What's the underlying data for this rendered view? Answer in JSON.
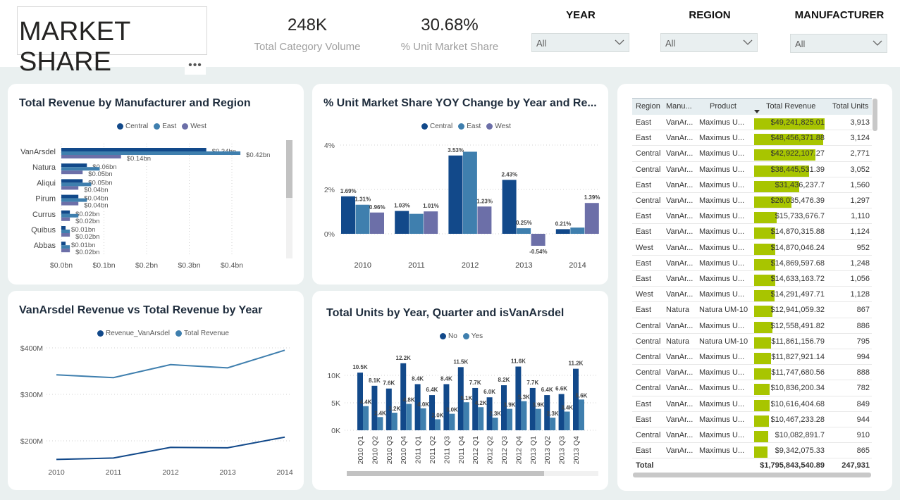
{
  "header": {
    "title": "MARKET SHARE",
    "more": "•••",
    "kpi1": {
      "value": "248K",
      "label": "Total Category Volume"
    },
    "kpi2": {
      "value": "30.68%",
      "label": "% Unit Market Share"
    },
    "slicers": [
      {
        "title": "YEAR",
        "value": "All"
      },
      {
        "title": "REGION",
        "value": "All"
      },
      {
        "title": "MANUFACTURER",
        "value": "All"
      }
    ]
  },
  "colors": {
    "central": "#12498a",
    "east": "#3f7fae",
    "west": "#6c6fa8",
    "no": "#12498a",
    "yes": "#3f7fae",
    "bar_green": "#a8c500"
  },
  "revenue_chart": {
    "title": "Total Revenue by Manufacturer and Region",
    "legend": [
      "Central",
      "East",
      "West"
    ],
    "chart_data": {
      "type": "bar",
      "categories": [
        "VanArsdel",
        "Natura",
        "Aliqui",
        "Pirum",
        "Currus",
        "Quibus",
        "Abbas"
      ],
      "series": [
        {
          "name": "Central",
          "values": [
            0.34,
            0.06,
            0.05,
            0.04,
            0.02,
            0.01,
            0.01
          ]
        },
        {
          "name": "East",
          "values": [
            0.42,
            0.09,
            0.07,
            0.06,
            0.04,
            0.02,
            0.02
          ]
        },
        {
          "name": "West",
          "values": [
            0.14,
            0.05,
            0.04,
            0.04,
            0.02,
            0.02,
            0.02
          ]
        }
      ],
      "labels": [
        [
          "$0.34bn",
          "$0.42bn",
          "$0.14bn"
        ],
        [
          "$0.06bn",
          "",
          "$0.05bn"
        ],
        [
          "$0.05bn",
          "",
          "$0.04bn"
        ],
        [
          "$0.04bn",
          "",
          "$0.04bn"
        ],
        [
          "$0.02bn",
          "",
          "$0.02bn"
        ],
        [
          "$0.01bn",
          "",
          "$0.02bn"
        ],
        [
          "$0.01bn",
          "",
          "$0.02bn"
        ]
      ],
      "xticks": [
        "$0.0bn",
        "$0.1bn",
        "$0.2bn",
        "$0.3bn",
        "$0.4bn"
      ],
      "xlim": [
        0,
        0.45
      ]
    }
  },
  "yoy_chart": {
    "title": "% Unit Market Share YOY Change by Year and Re...",
    "legend": [
      "Central",
      "East",
      "West"
    ],
    "chart_data": {
      "type": "bar",
      "categories": [
        "2010",
        "2011",
        "2012",
        "2013",
        "2014"
      ],
      "series": [
        {
          "name": "Central",
          "values": [
            1.69,
            1.03,
            3.53,
            2.43,
            0.21
          ]
        },
        {
          "name": "East",
          "values": [
            1.31,
            0.9,
            3.7,
            0.25,
            0.28
          ]
        },
        {
          "name": "West",
          "values": [
            0.96,
            1.01,
            1.23,
            -0.54,
            1.39
          ]
        }
      ],
      "labels": [
        [
          "1.69%",
          "1.31%",
          "0.96%"
        ],
        [
          "1.03%",
          "",
          "1.01%"
        ],
        [
          "3.53%",
          "",
          "1.23%"
        ],
        [
          "2.43%",
          "0.25%",
          "-0.54%"
        ],
        [
          "0.21%",
          "",
          "1.39%"
        ]
      ],
      "yticks": [
        "4%",
        "2%",
        "0%"
      ],
      "ylim": [
        -0.9,
        4.2
      ]
    }
  },
  "line_chart": {
    "title": "VanArsdel Revenue vs Total Revenue by Year",
    "legend": [
      "Revenue_VanArsdel",
      "Total Revenue"
    ],
    "chart_data": {
      "type": "line",
      "x": [
        "2010",
        "2011",
        "2012",
        "2013",
        "2014"
      ],
      "series": [
        {
          "name": "Revenue_VanArsdel",
          "values": [
            160,
            163,
            186,
            185,
            208
          ]
        },
        {
          "name": "Total Revenue",
          "values": [
            342,
            336,
            364,
            357,
            395
          ]
        }
      ],
      "yticks": [
        "$400M",
        "$300M",
        "$200M"
      ],
      "ylim": [
        150,
        410
      ]
    }
  },
  "units_chart": {
    "title": "Total Units by Year, Quarter and isVanArsdel",
    "legend": [
      "No",
      "Yes"
    ],
    "chart_data": {
      "type": "bar",
      "categories": [
        "2010 Q1",
        "2010 Q2",
        "2010 Q3",
        "2010 Q4",
        "2011 Q1",
        "2011 Q2",
        "2011 Q3",
        "2011 Q4",
        "2012 Q1",
        "2012 Q2",
        "2012 Q3",
        "2012 Q4",
        "2013 Q1",
        "2013 Q2",
        "2013 Q3",
        "2013 Q4"
      ],
      "series": [
        {
          "name": "No",
          "values": [
            10.5,
            8.1,
            7.6,
            12.2,
            8.4,
            6.4,
            8.4,
            11.5,
            7.7,
            6.0,
            8.2,
            11.6,
            7.7,
            6.4,
            6.6,
            11.2
          ]
        },
        {
          "name": "Yes",
          "values": [
            4.4,
            2.4,
            3.2,
            4.8,
            4.0,
            2.0,
            3.0,
            5.1,
            4.2,
            2.3,
            3.9,
            5.3,
            3.9,
            2.3,
            3.4,
            5.6
          ]
        }
      ],
      "labels_no": [
        "10.5K",
        "8.1K",
        "7.6K",
        "12.2K",
        "8.4K",
        "6.4K",
        "8.4K",
        "11.5K",
        "7.7K",
        "6.0K",
        "8.2K",
        "11.6K",
        "7.7K",
        "6.4K",
        "6.6K",
        "11.2K"
      ],
      "labels_yes": [
        "4.4K",
        "2.4K",
        "3.2K",
        "4.8K",
        "4.0K",
        "2.0K",
        "3.0K",
        "5.1K",
        "4.2K",
        "2.3K",
        "3.9K",
        "5.3K",
        "3.9K",
        "2.3K",
        "3.4K",
        "5.6K"
      ],
      "yticks": [
        "10K",
        "5K",
        "0K"
      ],
      "ylim": [
        0,
        13
      ]
    }
  },
  "table": {
    "columns": [
      "Region",
      "Manu...",
      "Product",
      "Total Revenue",
      "Total Units"
    ],
    "rows": [
      {
        "region": "East",
        "manu": "VanAr...",
        "product": "Maximus U...",
        "revenue": "$49,241,825.01",
        "rev_value": 49.24,
        "units": "3,913"
      },
      {
        "region": "East",
        "manu": "VanAr...",
        "product": "Maximus U...",
        "revenue": "$48,456,371.88",
        "rev_value": 48.46,
        "units": "3,124"
      },
      {
        "region": "Central",
        "manu": "VanAr...",
        "product": "Maximus U...",
        "revenue": "$42,922,107.27",
        "rev_value": 42.92,
        "units": "2,771"
      },
      {
        "region": "Central",
        "manu": "VanAr...",
        "product": "Maximus U...",
        "revenue": "$38,445,531.39",
        "rev_value": 38.45,
        "units": "3,052"
      },
      {
        "region": "East",
        "manu": "VanAr...",
        "product": "Maximus U...",
        "revenue": "$31,436,237.7",
        "rev_value": 31.44,
        "units": "1,560"
      },
      {
        "region": "Central",
        "manu": "VanAr...",
        "product": "Maximus U...",
        "revenue": "$26,035,476.39",
        "rev_value": 26.04,
        "units": "1,297"
      },
      {
        "region": "East",
        "manu": "VanAr...",
        "product": "Maximus U...",
        "revenue": "$15,733,676.7",
        "rev_value": 15.73,
        "units": "1,110"
      },
      {
        "region": "East",
        "manu": "VanAr...",
        "product": "Maximus U...",
        "revenue": "$14,870,315.88",
        "rev_value": 14.87,
        "units": "1,124"
      },
      {
        "region": "West",
        "manu": "VanAr...",
        "product": "Maximus U...",
        "revenue": "$14,870,046.24",
        "rev_value": 14.87,
        "units": "952"
      },
      {
        "region": "East",
        "manu": "VanAr...",
        "product": "Maximus U...",
        "revenue": "$14,869,597.68",
        "rev_value": 14.87,
        "units": "1,248"
      },
      {
        "region": "East",
        "manu": "VanAr...",
        "product": "Maximus U...",
        "revenue": "$14,633,163.72",
        "rev_value": 14.63,
        "units": "1,056"
      },
      {
        "region": "West",
        "manu": "VanAr...",
        "product": "Maximus U...",
        "revenue": "$14,291,497.71",
        "rev_value": 14.29,
        "units": "1,128"
      },
      {
        "region": "East",
        "manu": "Natura",
        "product": "Natura UM-10",
        "revenue": "$12,941,059.32",
        "rev_value": 12.94,
        "units": "867"
      },
      {
        "region": "Central",
        "manu": "VanAr...",
        "product": "Maximus U...",
        "revenue": "$12,558,491.82",
        "rev_value": 12.56,
        "units": "886"
      },
      {
        "region": "Central",
        "manu": "Natura",
        "product": "Natura UM-10",
        "revenue": "$11,861,156.79",
        "rev_value": 11.86,
        "units": "795"
      },
      {
        "region": "Central",
        "manu": "VanAr...",
        "product": "Maximus U...",
        "revenue": "$11,827,921.14",
        "rev_value": 11.83,
        "units": "994"
      },
      {
        "region": "Central",
        "manu": "VanAr...",
        "product": "Maximus U...",
        "revenue": "$11,747,680.56",
        "rev_value": 11.75,
        "units": "888"
      },
      {
        "region": "Central",
        "manu": "VanAr...",
        "product": "Maximus U...",
        "revenue": "$10,836,200.34",
        "rev_value": 10.84,
        "units": "782"
      },
      {
        "region": "East",
        "manu": "VanAr...",
        "product": "Maximus U...",
        "revenue": "$10,616,404.68",
        "rev_value": 10.62,
        "units": "849"
      },
      {
        "region": "East",
        "manu": "VanAr...",
        "product": "Maximus U...",
        "revenue": "$10,467,233.28",
        "rev_value": 10.47,
        "units": "944"
      },
      {
        "region": "Central",
        "manu": "VanAr...",
        "product": "Maximus U...",
        "revenue": "$10,082,891.7",
        "rev_value": 10.08,
        "units": "910"
      },
      {
        "region": "East",
        "manu": "VanAr...",
        "product": "Maximus U...",
        "revenue": "$9,342,075.33",
        "rev_value": 9.34,
        "units": "865"
      }
    ],
    "total": {
      "label": "Total",
      "revenue": "$1,795,843,540.89",
      "units": "247,931"
    }
  }
}
